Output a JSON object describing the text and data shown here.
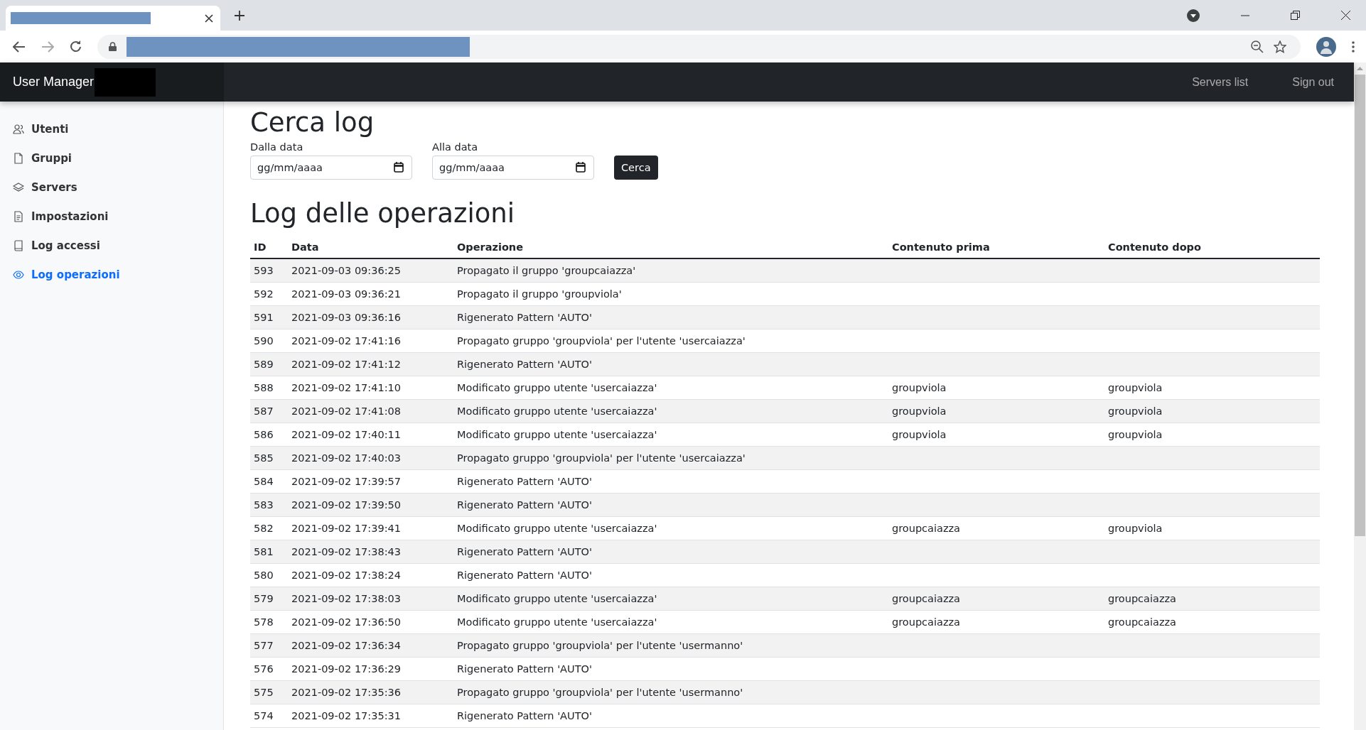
{
  "navbar": {
    "brand": "User Manager",
    "links": [
      "Servers list",
      "Sign out"
    ]
  },
  "sidebar": {
    "items": [
      {
        "label": "Utenti",
        "selected": false
      },
      {
        "label": "Gruppi",
        "selected": false
      },
      {
        "label": "Servers",
        "selected": false
      },
      {
        "label": "Impostazioni",
        "selected": false
      },
      {
        "label": "Log accessi",
        "selected": false
      },
      {
        "label": "Log operazioni",
        "selected": true
      }
    ]
  },
  "search": {
    "title": "Cerca log",
    "from": {
      "label": "Dalla data",
      "placeholder": "gg/mm/aaaa"
    },
    "to": {
      "label": "Alla data",
      "placeholder": "gg/mm/aaaa"
    },
    "button": "Cerca"
  },
  "table": {
    "title": "Log delle operazioni",
    "columns": [
      "ID",
      "Data",
      "Operazione",
      "Contenuto prima",
      "Contenuto dopo"
    ],
    "rows": [
      [
        "593",
        "2021-09-03 09:36:25",
        "Propagato il gruppo 'groupcaiazza'"
      ],
      [
        "592",
        "2021-09-03 09:36:21",
        "Propagato il gruppo 'groupviola'"
      ],
      [
        "591",
        "2021-09-03 09:36:16",
        "Rigenerato Pattern 'AUTO'"
      ],
      [
        "590",
        "2021-09-02 17:41:16",
        "Propagato gruppo 'groupviola' per l'utente 'usercaiazza'"
      ],
      [
        "589",
        "2021-09-02 17:41:12",
        "Rigenerato Pattern 'AUTO'"
      ],
      [
        "588",
        "2021-09-02 17:41:10",
        "Modificato gruppo utente 'usercaiazza'",
        "groupviola",
        "groupviola"
      ],
      [
        "587",
        "2021-09-02 17:41:08",
        "Modificato gruppo utente 'usercaiazza'",
        "groupviola",
        "groupviola"
      ],
      [
        "586",
        "2021-09-02 17:40:11",
        "Modificato gruppo utente 'usercaiazza'",
        "groupviola",
        "groupviola"
      ],
      [
        "585",
        "2021-09-02 17:40:03",
        "Propagato gruppo 'groupviola' per l'utente 'usercaiazza'"
      ],
      [
        "584",
        "2021-09-02 17:39:57",
        "Rigenerato Pattern 'AUTO'"
      ],
      [
        "583",
        "2021-09-02 17:39:50",
        "Rigenerato Pattern 'AUTO'"
      ],
      [
        "582",
        "2021-09-02 17:39:41",
        "Modificato gruppo utente 'usercaiazza'",
        "groupcaiazza",
        "groupviola"
      ],
      [
        "581",
        "2021-09-02 17:38:43",
        "Rigenerato Pattern 'AUTO'"
      ],
      [
        "580",
        "2021-09-02 17:38:24",
        "Rigenerato Pattern 'AUTO'"
      ],
      [
        "579",
        "2021-09-02 17:38:03",
        "Modificato gruppo utente 'usercaiazza'",
        "groupcaiazza",
        "groupcaiazza"
      ],
      [
        "578",
        "2021-09-02 17:36:50",
        "Modificato gruppo utente 'usercaiazza'",
        "groupcaiazza",
        "groupcaiazza"
      ],
      [
        "577",
        "2021-09-02 17:36:34",
        "Propagato gruppo 'groupviola' per l'utente 'usermanno'"
      ],
      [
        "576",
        "2021-09-02 17:36:29",
        "Rigenerato Pattern 'AUTO'"
      ],
      [
        "575",
        "2021-09-02 17:35:36",
        "Propagato gruppo 'groupviola' per l'utente 'usermanno'"
      ],
      [
        "574",
        "2021-09-02 17:35:31",
        "Rigenerato Pattern 'AUTO'"
      ]
    ]
  }
}
